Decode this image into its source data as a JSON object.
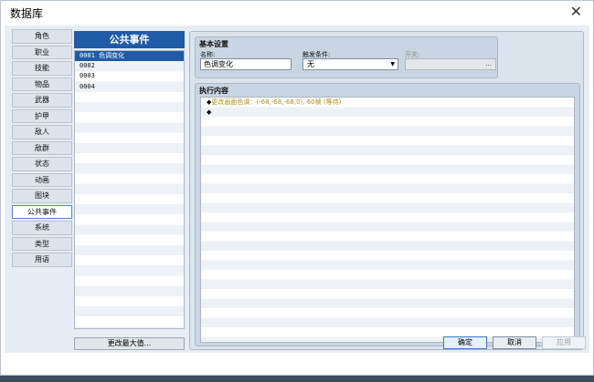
{
  "window": {
    "title": "数据库",
    "close_glyph": "✕"
  },
  "categories": [
    {
      "label": "角色",
      "selected": false
    },
    {
      "label": "职业",
      "selected": false
    },
    {
      "label": "技能",
      "selected": false
    },
    {
      "label": "物品",
      "selected": false
    },
    {
      "label": "武器",
      "selected": false
    },
    {
      "label": "护甲",
      "selected": false
    },
    {
      "label": "敌人",
      "selected": false
    },
    {
      "label": "敌群",
      "selected": false
    },
    {
      "label": "状态",
      "selected": false
    },
    {
      "label": "动画",
      "selected": false
    },
    {
      "label": "图块",
      "selected": false
    },
    {
      "label": "公共事件",
      "selected": true
    },
    {
      "label": "系统",
      "selected": false
    },
    {
      "label": "类型",
      "selected": false
    },
    {
      "label": "用语",
      "selected": false
    }
  ],
  "list": {
    "header": "公共事件",
    "items": [
      "0001 色调变化",
      "0002",
      "0003",
      "0004"
    ],
    "selected_index": 0,
    "max_button": "更改最大值..."
  },
  "basic": {
    "title": "基本设置",
    "name_label": "名称:",
    "name_value": "色调变化",
    "trigger_label": "触发条件:",
    "trigger_value": "无",
    "switch_label": "开关:",
    "switch_button": "..."
  },
  "exec": {
    "title": "执行内容",
    "commands": [
      {
        "marker": "◆",
        "text": "更改画面色调：(-68,-68,-68,0), 60帧 (等待)"
      },
      {
        "marker": "◆",
        "text": ""
      }
    ]
  },
  "buttons": {
    "ok": "确定",
    "cancel": "取消",
    "apply": "应用"
  },
  "colors": {
    "accent": "#1f5ba7",
    "command_text": "#b08e14"
  },
  "icons": {
    "close": "close-icon",
    "dropdown": "chevron-down-icon"
  }
}
